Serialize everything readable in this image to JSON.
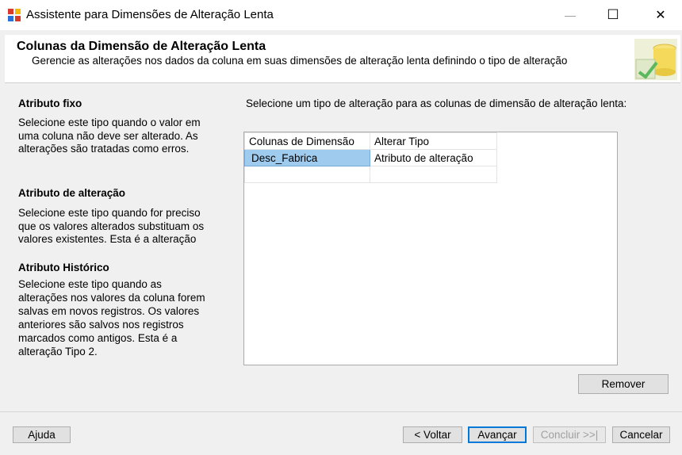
{
  "window": {
    "title": "Assistente para Dimensões de Alteração Lenta",
    "minimize_glyph": "—",
    "maximize_glyph": "☐",
    "close_glyph": "✕"
  },
  "header": {
    "title": "Colunas da Dimensão de Alteração Lenta",
    "subtitle": "Gerencie as alterações nos dados da coluna em suas dimensões de alteração lenta definindo o tipo de alteração"
  },
  "attributes": [
    {
      "title": "Atributo fixo",
      "description": "Selecione este tipo quando o valor em\numa coluna não deve ser alterado. As\nalterações são tratadas como erros."
    },
    {
      "title": "Atributo de alteração",
      "description": "Selecione este tipo quando for preciso\nque os valores alterados substituam os\nvalores existentes. Esta é a alteração"
    },
    {
      "title": "Atributo Histórico",
      "description": "Selecione este tipo quando as\nalterações nos valores da coluna forem\nsalvas em novos registros. Os valores\nanteriores são salvos nos registros\nmarcados como antigos. Esta é a\nalteração Tipo 2."
    }
  ],
  "instruction": "Selecione um tipo de alteração para as colunas de dimensão de alteração lenta:",
  "grid": {
    "headers": [
      "Colunas de Dimensão",
      "Alterar Tipo"
    ],
    "rows": [
      [
        "Desc_Fabrica",
        "Atributo de alteração"
      ],
      [
        "",
        ""
      ]
    ]
  },
  "buttons": {
    "remove": "Remover",
    "help": "Ajuda",
    "back": "< Voltar",
    "next": "Avançar",
    "finish": "Concluir >>|",
    "cancel": "Cancelar"
  },
  "colors": {
    "selection": "#9fcbef",
    "default_button_border": "#0078d7"
  }
}
